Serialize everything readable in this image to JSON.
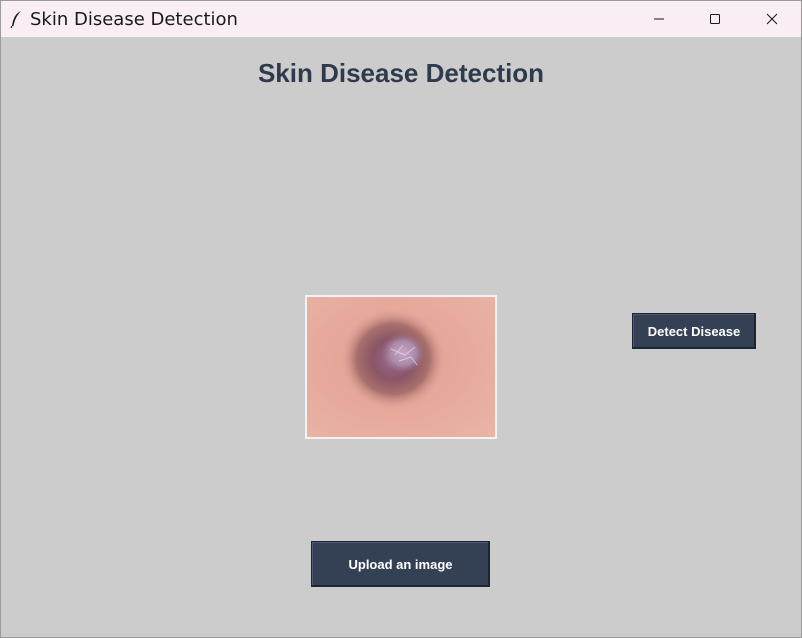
{
  "window": {
    "title": "Skin Disease Detection",
    "app_icon": "feather-icon"
  },
  "window_controls": {
    "minimize_icon": "minimize-icon",
    "maximize_icon": "maximize-icon",
    "close_icon": "close-icon"
  },
  "main": {
    "heading": "Skin Disease Detection",
    "preview_image": "skin-lesion-photo",
    "detect_button_label": "Detect Disease",
    "upload_button_label": "Upload an image"
  },
  "colors": {
    "background": "#cccccc",
    "titlebar": "#f9eef4",
    "heading": "#2f3a4d",
    "button": "#344155",
    "button_text": "#ffffff"
  }
}
